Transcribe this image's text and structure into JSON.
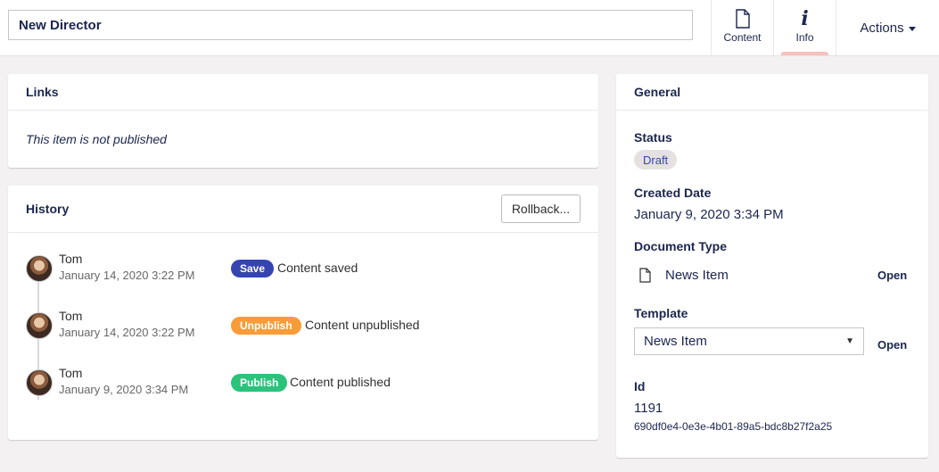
{
  "header": {
    "name_value": "New Director",
    "apps": [
      {
        "label": "Content",
        "icon": "document-icon"
      },
      {
        "label": "Info",
        "icon": "info-icon"
      }
    ],
    "actions_label": "Actions"
  },
  "links": {
    "title": "Links",
    "message": "This item is not published"
  },
  "history": {
    "title": "History",
    "rollback_label": "Rollback...",
    "entries": [
      {
        "user": "Tom",
        "date": "January 14, 2020 3:22 PM",
        "badge": "Save",
        "badge_color": "#3544b1",
        "message": "Content saved"
      },
      {
        "user": "Tom",
        "date": "January 14, 2020 3:22 PM",
        "badge": "Unpublish",
        "badge_color": "#f79c37",
        "message": "Content unpublished"
      },
      {
        "user": "Tom",
        "date": "January 9, 2020 3:34 PM",
        "badge": "Publish",
        "badge_color": "#2bc37c",
        "message": "Content published"
      }
    ]
  },
  "general": {
    "title": "General",
    "status_label": "Status",
    "status_value": "Draft",
    "created_label": "Created Date",
    "created_value": "January 9, 2020 3:34 PM",
    "doctype_label": "Document Type",
    "doctype_value": "News Item",
    "doctype_open": "Open",
    "template_label": "Template",
    "template_value": "News Item",
    "template_open": "Open",
    "id_label": "Id",
    "id_value": "1191",
    "guid_value": "690df0e4-0e3e-4b01-89a5-bdc8b27f2a25"
  },
  "colors": {
    "accent": "#1b264f",
    "save": "#3544b1",
    "unpublish": "#f79c37",
    "publish": "#2bc37c",
    "active_tab": "#f5c1bc"
  }
}
